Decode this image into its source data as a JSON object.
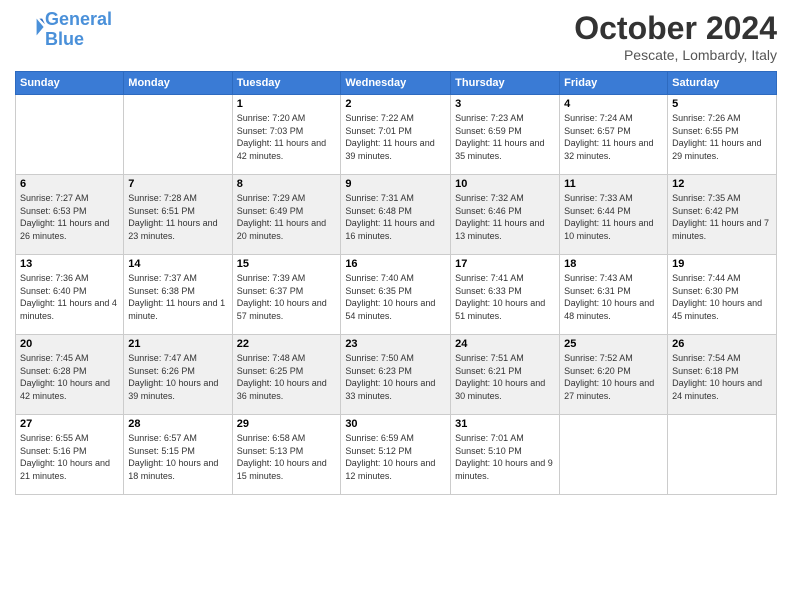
{
  "header": {
    "logo_line1": "General",
    "logo_line2": "Blue",
    "month": "October 2024",
    "location": "Pescate, Lombardy, Italy"
  },
  "weekdays": [
    "Sunday",
    "Monday",
    "Tuesday",
    "Wednesday",
    "Thursday",
    "Friday",
    "Saturday"
  ],
  "weeks": [
    [
      {
        "day": "",
        "info": ""
      },
      {
        "day": "",
        "info": ""
      },
      {
        "day": "1",
        "info": "Sunrise: 7:20 AM\nSunset: 7:03 PM\nDaylight: 11 hours and 42 minutes."
      },
      {
        "day": "2",
        "info": "Sunrise: 7:22 AM\nSunset: 7:01 PM\nDaylight: 11 hours and 39 minutes."
      },
      {
        "day": "3",
        "info": "Sunrise: 7:23 AM\nSunset: 6:59 PM\nDaylight: 11 hours and 35 minutes."
      },
      {
        "day": "4",
        "info": "Sunrise: 7:24 AM\nSunset: 6:57 PM\nDaylight: 11 hours and 32 minutes."
      },
      {
        "day": "5",
        "info": "Sunrise: 7:26 AM\nSunset: 6:55 PM\nDaylight: 11 hours and 29 minutes."
      }
    ],
    [
      {
        "day": "6",
        "info": "Sunrise: 7:27 AM\nSunset: 6:53 PM\nDaylight: 11 hours and 26 minutes."
      },
      {
        "day": "7",
        "info": "Sunrise: 7:28 AM\nSunset: 6:51 PM\nDaylight: 11 hours and 23 minutes."
      },
      {
        "day": "8",
        "info": "Sunrise: 7:29 AM\nSunset: 6:49 PM\nDaylight: 11 hours and 20 minutes."
      },
      {
        "day": "9",
        "info": "Sunrise: 7:31 AM\nSunset: 6:48 PM\nDaylight: 11 hours and 16 minutes."
      },
      {
        "day": "10",
        "info": "Sunrise: 7:32 AM\nSunset: 6:46 PM\nDaylight: 11 hours and 13 minutes."
      },
      {
        "day": "11",
        "info": "Sunrise: 7:33 AM\nSunset: 6:44 PM\nDaylight: 11 hours and 10 minutes."
      },
      {
        "day": "12",
        "info": "Sunrise: 7:35 AM\nSunset: 6:42 PM\nDaylight: 11 hours and 7 minutes."
      }
    ],
    [
      {
        "day": "13",
        "info": "Sunrise: 7:36 AM\nSunset: 6:40 PM\nDaylight: 11 hours and 4 minutes."
      },
      {
        "day": "14",
        "info": "Sunrise: 7:37 AM\nSunset: 6:38 PM\nDaylight: 11 hours and 1 minute."
      },
      {
        "day": "15",
        "info": "Sunrise: 7:39 AM\nSunset: 6:37 PM\nDaylight: 10 hours and 57 minutes."
      },
      {
        "day": "16",
        "info": "Sunrise: 7:40 AM\nSunset: 6:35 PM\nDaylight: 10 hours and 54 minutes."
      },
      {
        "day": "17",
        "info": "Sunrise: 7:41 AM\nSunset: 6:33 PM\nDaylight: 10 hours and 51 minutes."
      },
      {
        "day": "18",
        "info": "Sunrise: 7:43 AM\nSunset: 6:31 PM\nDaylight: 10 hours and 48 minutes."
      },
      {
        "day": "19",
        "info": "Sunrise: 7:44 AM\nSunset: 6:30 PM\nDaylight: 10 hours and 45 minutes."
      }
    ],
    [
      {
        "day": "20",
        "info": "Sunrise: 7:45 AM\nSunset: 6:28 PM\nDaylight: 10 hours and 42 minutes."
      },
      {
        "day": "21",
        "info": "Sunrise: 7:47 AM\nSunset: 6:26 PM\nDaylight: 10 hours and 39 minutes."
      },
      {
        "day": "22",
        "info": "Sunrise: 7:48 AM\nSunset: 6:25 PM\nDaylight: 10 hours and 36 minutes."
      },
      {
        "day": "23",
        "info": "Sunrise: 7:50 AM\nSunset: 6:23 PM\nDaylight: 10 hours and 33 minutes."
      },
      {
        "day": "24",
        "info": "Sunrise: 7:51 AM\nSunset: 6:21 PM\nDaylight: 10 hours and 30 minutes."
      },
      {
        "day": "25",
        "info": "Sunrise: 7:52 AM\nSunset: 6:20 PM\nDaylight: 10 hours and 27 minutes."
      },
      {
        "day": "26",
        "info": "Sunrise: 7:54 AM\nSunset: 6:18 PM\nDaylight: 10 hours and 24 minutes."
      }
    ],
    [
      {
        "day": "27",
        "info": "Sunrise: 6:55 AM\nSunset: 5:16 PM\nDaylight: 10 hours and 21 minutes."
      },
      {
        "day": "28",
        "info": "Sunrise: 6:57 AM\nSunset: 5:15 PM\nDaylight: 10 hours and 18 minutes."
      },
      {
        "day": "29",
        "info": "Sunrise: 6:58 AM\nSunset: 5:13 PM\nDaylight: 10 hours and 15 minutes."
      },
      {
        "day": "30",
        "info": "Sunrise: 6:59 AM\nSunset: 5:12 PM\nDaylight: 10 hours and 12 minutes."
      },
      {
        "day": "31",
        "info": "Sunrise: 7:01 AM\nSunset: 5:10 PM\nDaylight: 10 hours and 9 minutes."
      },
      {
        "day": "",
        "info": ""
      },
      {
        "day": "",
        "info": ""
      }
    ]
  ]
}
